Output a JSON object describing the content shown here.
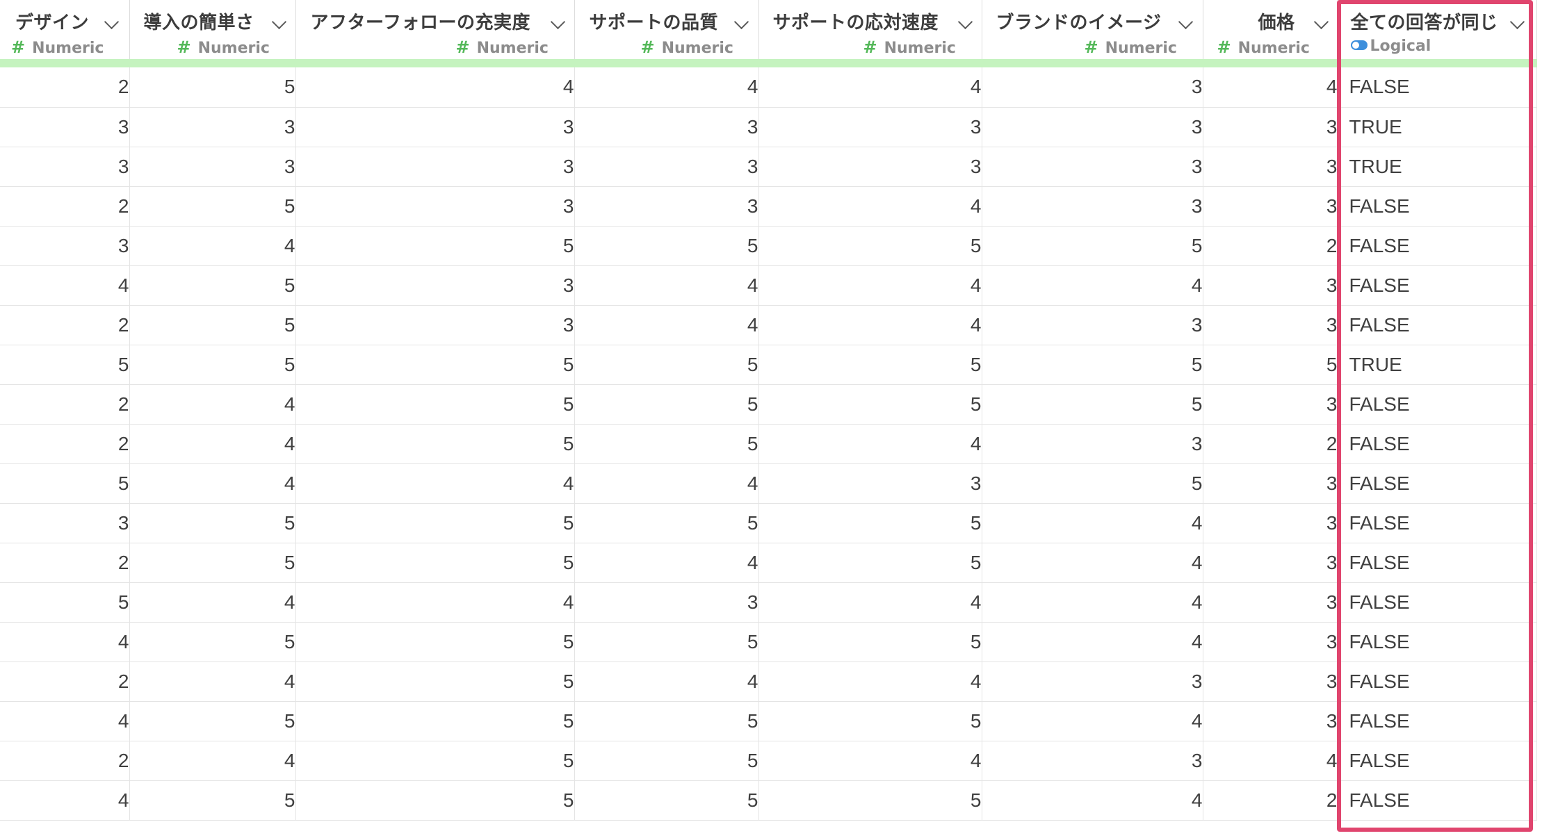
{
  "columns": [
    {
      "title": "デザイン",
      "type_label": "Numeric",
      "type_icon": "hash-icon"
    },
    {
      "title": "導入の簡単さ",
      "type_label": "Numeric",
      "type_icon": "hash-icon"
    },
    {
      "title": "アフターフォローの充実度",
      "type_label": "Numeric",
      "type_icon": "hash-icon"
    },
    {
      "title": "サポートの品質",
      "type_label": "Numeric",
      "type_icon": "hash-icon"
    },
    {
      "title": "サポートの応対速度",
      "type_label": "Numeric",
      "type_icon": "hash-icon"
    },
    {
      "title": "ブランドのイメージ",
      "type_label": "Numeric",
      "type_icon": "hash-icon"
    },
    {
      "title": "価格",
      "type_label": "Numeric",
      "type_icon": "hash-icon"
    },
    {
      "title": "全ての回答が同じ",
      "type_label": "Logical",
      "type_icon": "toggle-icon"
    }
  ],
  "rows": [
    [
      "2",
      "5",
      "4",
      "4",
      "4",
      "3",
      "4",
      "FALSE"
    ],
    [
      "3",
      "3",
      "3",
      "3",
      "3",
      "3",
      "3",
      "TRUE"
    ],
    [
      "3",
      "3",
      "3",
      "3",
      "3",
      "3",
      "3",
      "TRUE"
    ],
    [
      "2",
      "5",
      "3",
      "3",
      "4",
      "3",
      "3",
      "FALSE"
    ],
    [
      "3",
      "4",
      "5",
      "5",
      "5",
      "5",
      "2",
      "FALSE"
    ],
    [
      "4",
      "5",
      "3",
      "4",
      "4",
      "4",
      "3",
      "FALSE"
    ],
    [
      "2",
      "5",
      "3",
      "4",
      "4",
      "3",
      "3",
      "FALSE"
    ],
    [
      "5",
      "5",
      "5",
      "5",
      "5",
      "5",
      "5",
      "TRUE"
    ],
    [
      "2",
      "4",
      "5",
      "5",
      "5",
      "5",
      "3",
      "FALSE"
    ],
    [
      "2",
      "4",
      "5",
      "5",
      "4",
      "3",
      "2",
      "FALSE"
    ],
    [
      "5",
      "4",
      "4",
      "4",
      "3",
      "5",
      "3",
      "FALSE"
    ],
    [
      "3",
      "5",
      "5",
      "5",
      "5",
      "4",
      "3",
      "FALSE"
    ],
    [
      "2",
      "5",
      "5",
      "4",
      "5",
      "4",
      "3",
      "FALSE"
    ],
    [
      "5",
      "4",
      "4",
      "3",
      "4",
      "4",
      "3",
      "FALSE"
    ],
    [
      "4",
      "5",
      "5",
      "5",
      "5",
      "4",
      "3",
      "FALSE"
    ],
    [
      "2",
      "4",
      "5",
      "4",
      "4",
      "3",
      "3",
      "FALSE"
    ],
    [
      "4",
      "5",
      "5",
      "5",
      "5",
      "4",
      "3",
      "FALSE"
    ],
    [
      "2",
      "4",
      "5",
      "5",
      "4",
      "3",
      "4",
      "FALSE"
    ],
    [
      "4",
      "5",
      "5",
      "5",
      "5",
      "4",
      "2",
      "FALSE"
    ]
  ],
  "colors": {
    "accent_highlight": "#e0456e",
    "numeric_icon": "#54b859",
    "logical_icon": "#3d8fdc",
    "quality_bar": "#c5f3bf"
  }
}
